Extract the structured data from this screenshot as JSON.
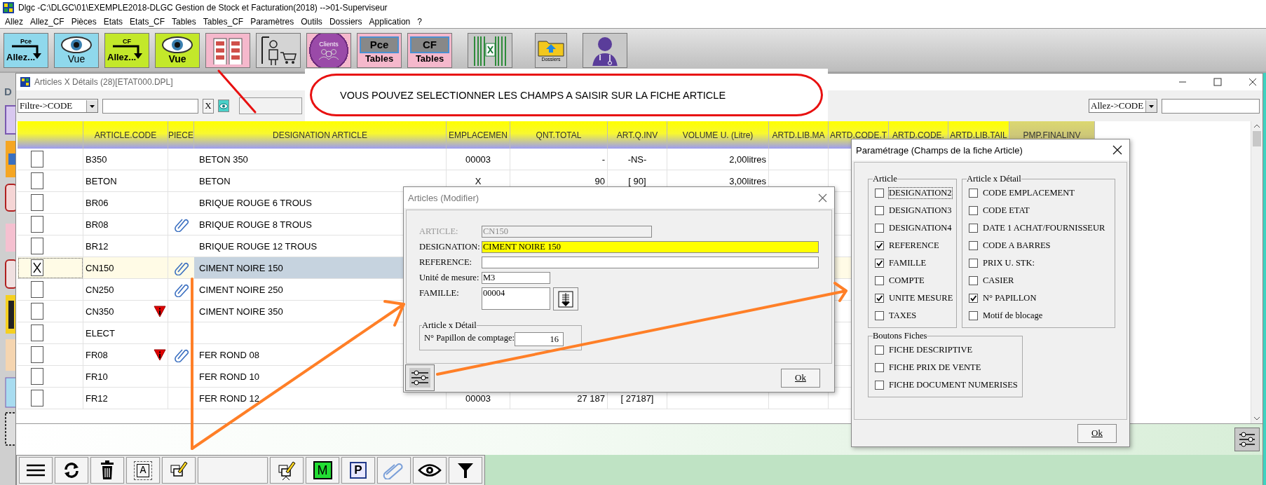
{
  "window": {
    "title": "Dlgc -C:\\DLGC\\01\\EXEMPLE2018-DLGC Gestion de Stock et Facturation(2018) -->01-Superviseur"
  },
  "menu": [
    "Allez",
    "Allez_CF",
    "Pièces",
    "Etats",
    "Etats_CF",
    "Tables",
    "Tables_CF",
    "Paramètres",
    "Outils",
    "Dossiers",
    "Application",
    "?"
  ],
  "toolbar": [
    {
      "kind": "goto",
      "top": "Pce",
      "label": "Allez...",
      "color": "#8fd8ec"
    },
    {
      "kind": "view",
      "label": "Vue",
      "color": "#8fd8ec"
    },
    {
      "kind": "goto",
      "top": "CF",
      "label": "Allez...",
      "color": "#c3e82a"
    },
    {
      "kind": "view",
      "label": "Vue",
      "color": "#c3e82a"
    },
    {
      "kind": "grid",
      "color": "#f5b8cc"
    },
    {
      "kind": "cart",
      "color": "#d4d4d4"
    },
    {
      "kind": "clients",
      "label": "Clients",
      "color": "#f5b8cc"
    },
    {
      "kind": "tables",
      "top": "Pce",
      "label": "Tables",
      "color": "#f5b8cc"
    },
    {
      "kind": "tables",
      "top": "CF",
      "label": "Tables",
      "color": "#f5b8cc"
    },
    {
      "kind": "excel",
      "color": "#c8c8c8"
    },
    {
      "kind": "folder",
      "label": "Dossiers",
      "color": "#c8c8c8"
    },
    {
      "kind": "doctor",
      "color": "#c8c8c8"
    }
  ],
  "background_window": {
    "title": "D"
  },
  "articles_window": {
    "title": "Articles X Détails (28)[ETAT000.DPL]",
    "filter": "Filtre->CODE",
    "clear": "X",
    "goto": "Allez->CODE"
  },
  "table": {
    "columns": [
      {
        "label": "ARTICLE.CODE",
        "highlighted": false
      },
      {
        "label": "PIECE",
        "highlighted": false
      },
      {
        "label": "DESIGNATION ARTICLE",
        "highlighted": false
      },
      {
        "label": "EMPLACEMEN",
        "highlighted": false
      },
      {
        "label": "QNT.TOTAL",
        "highlighted": false
      },
      {
        "label": "ART.Q.INV",
        "highlighted": false
      },
      {
        "label": "VOLUME U. (Litre)",
        "highlighted": false
      },
      {
        "label": "ARTD.LIB.MA",
        "highlighted": false
      },
      {
        "label": "ARTD.CODE.T",
        "highlighted": false
      },
      {
        "label": "ARTD.CODE.",
        "highlighted": false
      },
      {
        "label": "ARTD.LIB.TAIL",
        "highlighted": false
      },
      {
        "label": "PMP.FINALINV",
        "highlighted": true
      }
    ],
    "rows": [
      {
        "checked": false,
        "selected": false,
        "code": "B350",
        "warning": false,
        "attachment": false,
        "designation": "BETON 350",
        "values": [
          "00003",
          "-",
          "-NS-",
          "2,00litres"
        ]
      },
      {
        "checked": false,
        "selected": false,
        "code": "BETON",
        "warning": false,
        "attachment": false,
        "designation": "BETON",
        "values": [
          "X",
          "90",
          "[ 90]",
          "3,00litres"
        ]
      },
      {
        "checked": false,
        "selected": false,
        "code": "BR06",
        "warning": false,
        "attachment": false,
        "designation": "BRIQUE ROUGE 6 TROUS"
      },
      {
        "checked": false,
        "selected": false,
        "code": "BR08",
        "warning": false,
        "attachment": true,
        "designation": "BRIQUE ROUGE 8 TROUS"
      },
      {
        "checked": false,
        "selected": false,
        "code": "BR12",
        "warning": false,
        "attachment": false,
        "designation": "BRIQUE ROUGE 12 TROUS"
      },
      {
        "checked": true,
        "selected": true,
        "code": "CN150",
        "warning": false,
        "attachment": true,
        "designation": "CIMENT NOIRE 150"
      },
      {
        "checked": false,
        "selected": false,
        "code": "CN250",
        "warning": false,
        "attachment": true,
        "designation": "CIMENT NOIRE 250"
      },
      {
        "checked": false,
        "selected": false,
        "code": "CN350",
        "warning": true,
        "attachment": false,
        "designation": "CIMENT NOIRE 350"
      },
      {
        "checked": false,
        "selected": false,
        "code": "ELECT",
        "warning": false,
        "attachment": false
      },
      {
        "checked": false,
        "selected": false,
        "code": "FR08",
        "warning": true,
        "attachment": true,
        "designation": "FER ROND 08"
      },
      {
        "checked": false,
        "selected": false,
        "code": "FR10",
        "warning": false,
        "attachment": false,
        "designation": "FER ROND 10"
      },
      {
        "checked": false,
        "selected": false,
        "code": "FR12",
        "warning": false,
        "attachment": false,
        "designation": "FER ROND 12",
        "values": [
          "00003",
          "27 187",
          "[ 27187]"
        ]
      }
    ]
  },
  "bottom_toolbar": [
    {
      "kind": "menu"
    },
    {
      "kind": "refresh"
    },
    {
      "kind": "delete"
    },
    {
      "kind": "label",
      "text": "A"
    },
    {
      "kind": "edit"
    },
    {
      "kind": "blank"
    },
    {
      "kind": "edit-down"
    },
    {
      "kind": "letter-green",
      "text": "M"
    },
    {
      "kind": "letter-blue",
      "text": "P"
    },
    {
      "kind": "attach"
    },
    {
      "kind": "view"
    },
    {
      "kind": "filter"
    }
  ],
  "annotation": {
    "text": "VOUS POUVEZ SELECTIONNER LES CHAMPS A SAISIR SUR LA FICHE  ARTICLE"
  },
  "article_dialog": {
    "title": "Articles  (Modifier)",
    "fields": [
      {
        "kind": "short",
        "label": "ARTICLE:",
        "value": "CN150",
        "disabled": true,
        "highlighted": false
      },
      {
        "kind": "long",
        "label": "DESIGNATION:",
        "value": "CIMENT NOIRE 150",
        "disabled": false,
        "highlighted": true
      },
      {
        "kind": "long",
        "label": "REFERENCE:",
        "disabled": false,
        "highlighted": false
      },
      {
        "kind": "unit",
        "label": "Unité de mesure:",
        "value": "M3",
        "disabled": false,
        "highlighted": false
      },
      {
        "kind": "lookup",
        "label": "FAMILLE:",
        "value": "00004",
        "disabled": false,
        "highlighted": false
      }
    ],
    "group": {
      "title": "Article x Détail",
      "label": "N° Papillon de comptage:",
      "value": "16"
    },
    "ok": "Ok"
  },
  "settings_dialog": {
    "title": "Paramétrage (Champs de la fiche Article)",
    "groups": [
      {
        "title": "Article",
        "items": [
          {
            "label": "DESIGNATION2",
            "checked": false,
            "focused": true
          },
          {
            "label": "DESIGNATION3",
            "checked": false,
            "focused": false
          },
          {
            "label": "DESIGNATION4",
            "checked": false,
            "focused": false
          },
          {
            "label": "REFERENCE",
            "checked": true,
            "focused": false
          },
          {
            "label": "FAMILLE",
            "checked": true,
            "focused": false
          },
          {
            "label": "COMPTE",
            "checked": false,
            "focused": false
          },
          {
            "label": "UNITE MESURE",
            "checked": true,
            "focused": false
          },
          {
            "label": "TAXES",
            "checked": false,
            "focused": false
          }
        ]
      },
      {
        "title": "Article x Détail",
        "items": [
          {
            "label": "CODE EMPLACEMENT",
            "checked": false,
            "focused": false
          },
          {
            "label": "CODE ETAT",
            "checked": false,
            "focused": false
          },
          {
            "label": "DATE 1 ACHAT/FOURNISSEUR",
            "checked": false,
            "focused": false
          },
          {
            "label": "CODE A BARRES",
            "checked": false,
            "focused": false
          },
          {
            "label": "PRIX U. STK:",
            "checked": false,
            "focused": false
          },
          {
            "label": "CASIER",
            "checked": false,
            "focused": false
          },
          {
            "label": "N° PAPILLON",
            "checked": true,
            "focused": false
          },
          {
            "label": "Motif de blocage",
            "checked": false,
            "focused": false
          }
        ]
      },
      {
        "title": "Boutons Fiches",
        "items": [
          {
            "label": "FICHE DESCRIPTIVE",
            "checked": false,
            "focused": false
          },
          {
            "label": "FICHE PRIX DE VENTE",
            "checked": false,
            "focused": false
          },
          {
            "label": "FICHE DOCUMENT NUMERISES",
            "checked": false,
            "focused": false
          }
        ]
      }
    ],
    "ok": "Ok"
  }
}
